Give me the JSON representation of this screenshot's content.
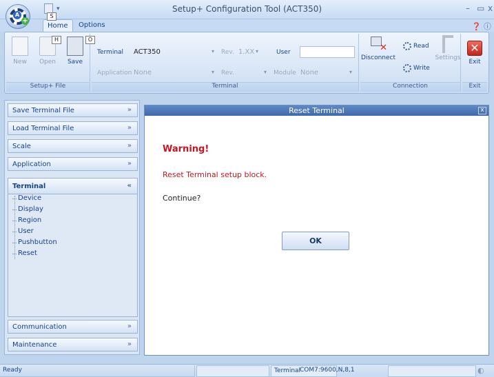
{
  "window": {
    "title": "Setup+ Configuration Tool (ACT350)",
    "minimize": "–",
    "maximize": "▭",
    "close": "x"
  },
  "quick_access": {
    "doc_icon": "document-icon",
    "dropdown_icon": "▾"
  },
  "keytips": {
    "s": "S",
    "h": "H",
    "o": "O"
  },
  "ribbon_tabs": [
    {
      "label": "Home"
    },
    {
      "label": "Options"
    }
  ],
  "help_icons": "❓ ⓘ",
  "ribbon": {
    "file_group": {
      "label": "Setup+ File",
      "new": "New",
      "open": "Open",
      "save": "Save"
    },
    "terminal_group": {
      "label": "Terminal",
      "terminal_label": "Terminal",
      "terminal_value": "ACT350",
      "rev_label": "Rev.",
      "rev_value": "1.XX",
      "user_label": "User",
      "user_value": "",
      "application_label": "Application",
      "application_value": "None",
      "rev2_label": "Rev.",
      "rev2_value": "",
      "module_label": "Module",
      "module_value": "None"
    },
    "connection_group": {
      "label": "Connection",
      "disconnect": "Disconnect",
      "read": "Read",
      "write": "Write",
      "settings": "Settings"
    },
    "exit_group": {
      "label": "Exit",
      "exit": "Exit"
    }
  },
  "left_panel": {
    "sections": [
      {
        "label": "Save Terminal File",
        "chev": "»"
      },
      {
        "label": "Load Terminal File",
        "chev": "»"
      },
      {
        "label": "Scale",
        "chev": "»"
      },
      {
        "label": "Application",
        "chev": "»"
      },
      {
        "label": "Terminal",
        "chev": "«"
      }
    ],
    "terminal_items": [
      "Device",
      "Display",
      "Region",
      "User",
      "Pushbutton",
      "Reset"
    ],
    "bottom_sections": [
      {
        "label": "Communication",
        "chev": "»"
      },
      {
        "label": "Maintenance",
        "chev": "»"
      }
    ]
  },
  "dialog": {
    "title": "Reset Terminal",
    "close": "x",
    "warning": "Warning!",
    "message": "Reset Terminal setup block.",
    "question": "Continue?",
    "ok": "OK"
  },
  "status": {
    "ready": "Ready",
    "terminal_label": "Terminal",
    "port": "COM7:9600,N,8,1"
  },
  "colors": {
    "warning": "#c8141e",
    "accent": "#15428b",
    "dialog_title": "#4a76b8"
  }
}
